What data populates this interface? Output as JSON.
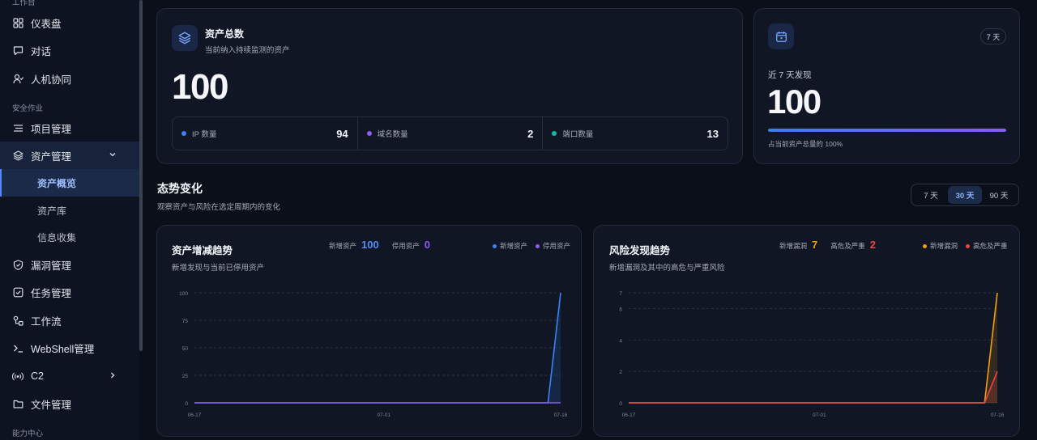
{
  "sidebar": {
    "section_workspace": "工作台",
    "section_security": "安全作业",
    "section_capability": "能力中心",
    "items": [
      {
        "label": "仪表盘",
        "icon": "dashboard-grid-icon"
      },
      {
        "label": "对话",
        "icon": "chat-bubble-icon"
      },
      {
        "label": "人机协同",
        "icon": "user-collab-icon"
      },
      {
        "label": "项目管理",
        "icon": "list-icon"
      },
      {
        "label": "资产管理",
        "icon": "layers-icon"
      },
      {
        "label": "漏洞管理",
        "icon": "shield-icon"
      },
      {
        "label": "任务管理",
        "icon": "checkbox-icon"
      },
      {
        "label": "工作流",
        "icon": "workflow-icon"
      },
      {
        "label": "WebShell管理",
        "icon": "terminal-icon"
      },
      {
        "label": "C2",
        "icon": "broadcast-icon"
      },
      {
        "label": "文件管理",
        "icon": "folder-icon"
      }
    ],
    "asset_sub": [
      "资产概览",
      "资产库",
      "信息收集"
    ]
  },
  "total_card": {
    "title": "资产总数",
    "subtitle": "当前纳入持续监测的资产",
    "value": "100",
    "metrics": [
      {
        "label": "IP 数量",
        "value": "94",
        "color": "#3b82f6"
      },
      {
        "label": "域名数量",
        "value": "2",
        "color": "#8b5cf6"
      },
      {
        "label": "端口数量",
        "value": "13",
        "color": "#14b8a6"
      }
    ]
  },
  "recent_card": {
    "badge": "7 天",
    "label": "近 7 天发现",
    "value": "100",
    "ratio_text": "占当前资产总量的 100%",
    "ratio": 1.0
  },
  "trend": {
    "title": "态势变化",
    "subtitle": "观察资产与风险在选定周期内的变化",
    "ranges": [
      "7 天",
      "30 天",
      "90 天"
    ],
    "active_range": "30 天"
  },
  "colors": {
    "blue": "#3b82f6",
    "purple": "#8b5cf6",
    "orange": "#f59e0b",
    "red": "#ef4444",
    "teal": "#14b8a6"
  },
  "asset_chart": {
    "title": "资产增减趋势",
    "subtitle": "新增发现与当前已停用资产",
    "summary": [
      {
        "label": "新增资产",
        "value": "100",
        "color": "#4f8ff7"
      },
      {
        "label": "停用资产",
        "value": "0",
        "color": "#8b5cf6"
      }
    ],
    "legend": [
      {
        "label": "新增资产",
        "color": "#3b82f6"
      },
      {
        "label": "停用资产",
        "color": "#8b5cf6"
      }
    ]
  },
  "risk_chart": {
    "title": "风险发现趋势",
    "subtitle": "新增漏洞及其中的高危与严重风险",
    "summary": [
      {
        "label": "新增漏洞",
        "value": "7",
        "color": "#f59e0b"
      },
      {
        "label": "高危及严重",
        "value": "2",
        "color": "#ef4444"
      }
    ],
    "legend": [
      {
        "label": "新增漏洞",
        "color": "#f59e0b"
      },
      {
        "label": "高危及严重",
        "color": "#ef4444"
      }
    ]
  },
  "chart_data": [
    {
      "type": "area",
      "title": "资产增减趋势",
      "x_ticks": [
        "06-17",
        "07-01",
        "07-16"
      ],
      "ylim": [
        0,
        100
      ],
      "y_ticks": [
        "0",
        "25",
        "50",
        "75",
        "100"
      ],
      "grid": true,
      "legend_position": "top-right",
      "points": 30,
      "series": [
        {
          "name": "新增资产",
          "color": "#3b82f6",
          "values": [
            0,
            0,
            0,
            0,
            0,
            0,
            0,
            0,
            0,
            0,
            0,
            0,
            0,
            0,
            0,
            0,
            0,
            0,
            0,
            0,
            0,
            0,
            0,
            0,
            0,
            0,
            0,
            0,
            0,
            100
          ]
        },
        {
          "name": "停用资产",
          "color": "#8b5cf6",
          "values": [
            0,
            0,
            0,
            0,
            0,
            0,
            0,
            0,
            0,
            0,
            0,
            0,
            0,
            0,
            0,
            0,
            0,
            0,
            0,
            0,
            0,
            0,
            0,
            0,
            0,
            0,
            0,
            0,
            0,
            0
          ]
        }
      ]
    },
    {
      "type": "area",
      "title": "风险发现趋势",
      "x_ticks": [
        "06-17",
        "07-01",
        "07-16"
      ],
      "ylim": [
        0,
        7
      ],
      "y_ticks": [
        "0",
        "2",
        "4",
        "6",
        "7"
      ],
      "grid": true,
      "legend_position": "top-right",
      "points": 30,
      "series": [
        {
          "name": "新增漏洞",
          "color": "#f59e0b",
          "values": [
            0,
            0,
            0,
            0,
            0,
            0,
            0,
            0,
            0,
            0,
            0,
            0,
            0,
            0,
            0,
            0,
            0,
            0,
            0,
            0,
            0,
            0,
            0,
            0,
            0,
            0,
            0,
            0,
            0,
            7
          ]
        },
        {
          "name": "高危及严重",
          "color": "#ef4444",
          "values": [
            0,
            0,
            0,
            0,
            0,
            0,
            0,
            0,
            0,
            0,
            0,
            0,
            0,
            0,
            0,
            0,
            0,
            0,
            0,
            0,
            0,
            0,
            0,
            0,
            0,
            0,
            0,
            0,
            0,
            2
          ]
        }
      ]
    }
  ]
}
